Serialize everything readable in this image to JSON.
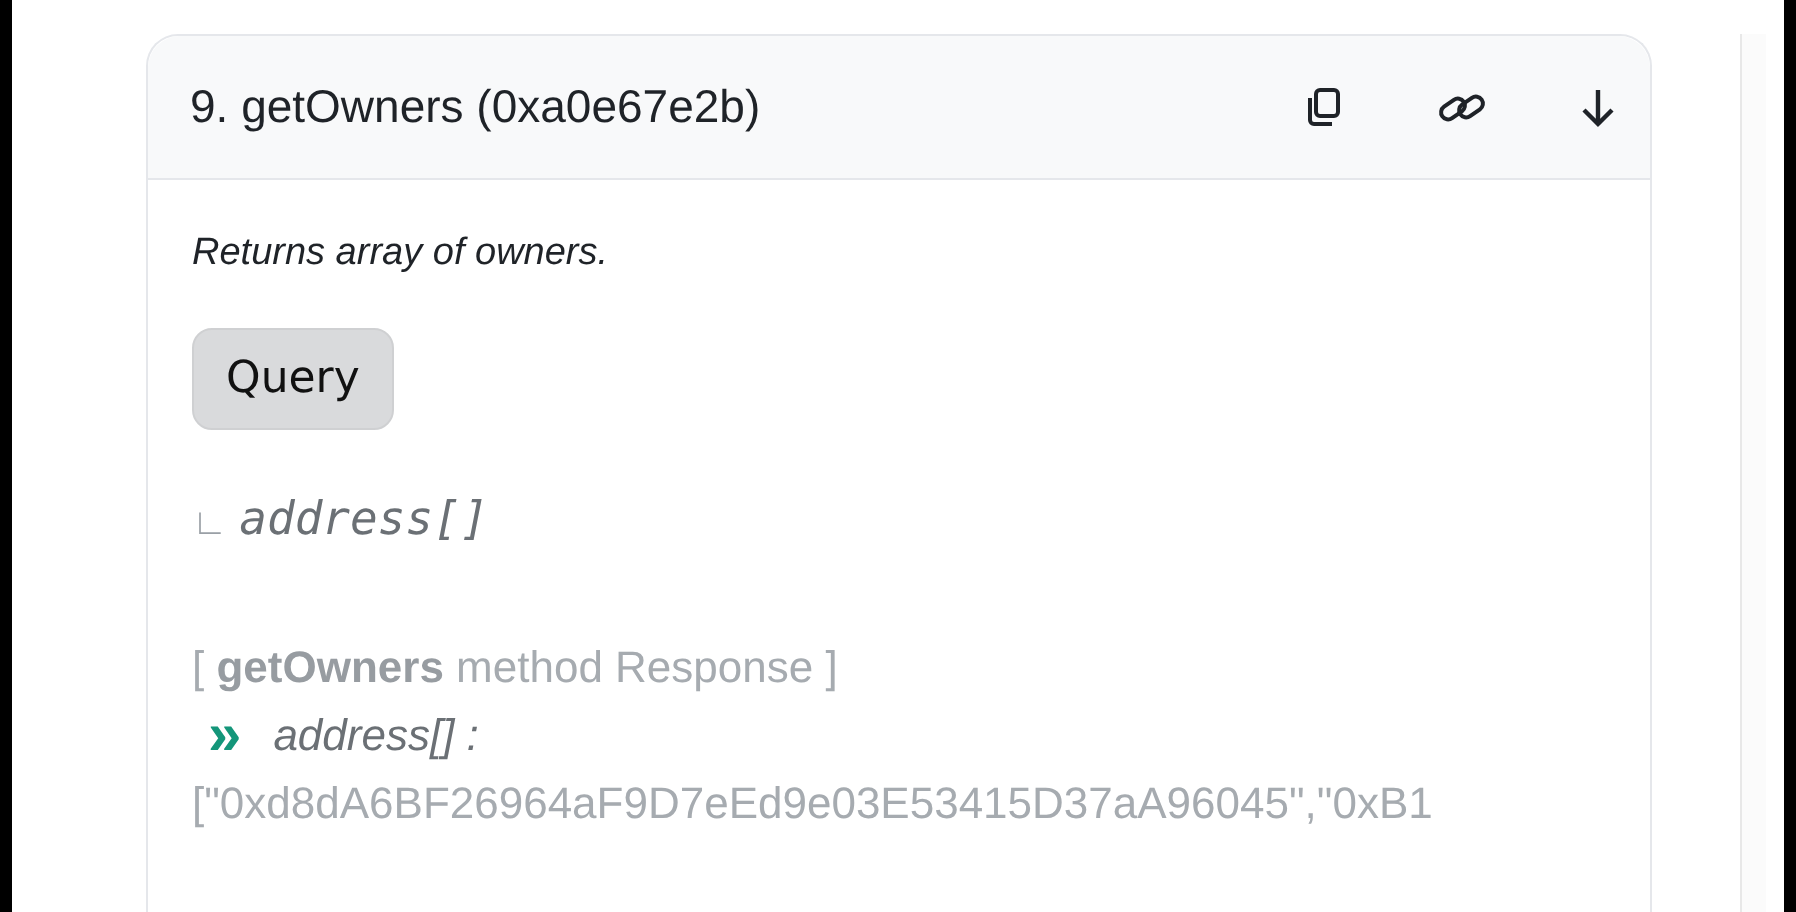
{
  "method": {
    "title": "9. getOwners (0xa0e67e2b)",
    "description": "Returns array of owners.",
    "query_button": "Query",
    "output_marker": "∟",
    "output_type": "address[]",
    "response": {
      "open": "[",
      "name": "getOwners",
      "label": "method Response",
      "close": "]",
      "chevron": "»",
      "type": "address[]",
      "colon": ":",
      "value": "[\"0xd8dA6BF26964aF9D7eEd9e03E53415D37aA96045\",\"0xB1"
    }
  }
}
